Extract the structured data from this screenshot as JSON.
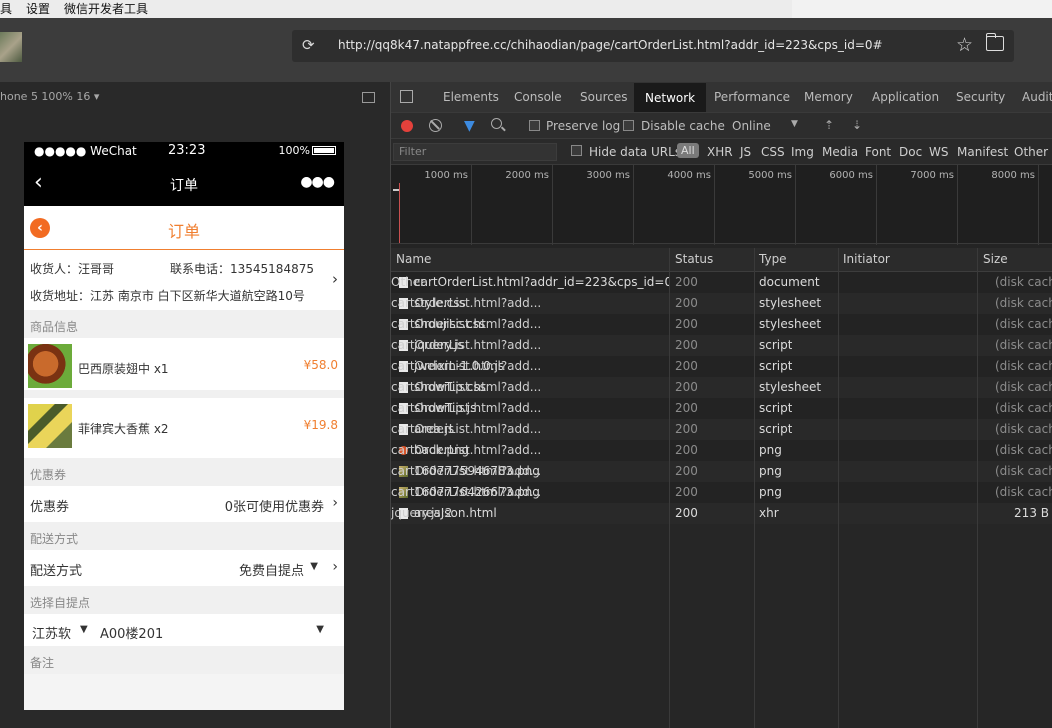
{
  "menu": {
    "items": [
      "具",
      "设置",
      "微信开发者工具"
    ]
  },
  "toolbar": {
    "url": "http://qq8k47.natappfree.cc/chihaodian/page/cartOrderList.html?addr_id=223&cps_id=0#"
  },
  "simulator": {
    "device_label": "hone 5 100% 16 ▾",
    "status": {
      "signal": "●●●●● WeChat",
      "time": "23:23",
      "battery": "100%"
    },
    "navbar_title": "订单",
    "order_title": "订单",
    "address": {
      "receiver": "收货人：汪哥哥",
      "phone": "联系电话：13545184875",
      "address": "收货地址：江苏 南京市 白下区新华大道航空路10号"
    },
    "goods_section": "商品信息",
    "products": [
      {
        "name": "巴西原装翅中 x1",
        "price": "¥58.0"
      },
      {
        "name": "菲律宾大香蕉 x2",
        "price": "¥19.8"
      }
    ],
    "coupon_section": "优惠券",
    "coupon_label": "优惠券",
    "coupon_value": "0张可使用优惠券",
    "delivery_section": "配送方式",
    "delivery_label": "配送方式",
    "delivery_value": "免费自提点",
    "pickup_section": "选择自提点",
    "pickup_province": "江苏软",
    "pickup_point": "A00楼201",
    "remark_section": "备注"
  },
  "devtools": {
    "tabs": [
      "Elements",
      "Console",
      "Sources",
      "Network",
      "Performance",
      "Memory",
      "Application",
      "Security",
      "Audit"
    ],
    "active_tab": "Network",
    "preserve_log": "Preserve log",
    "disable_cache": "Disable cache",
    "throttle": "Online",
    "filter_placeholder": "Filter",
    "hide_data_urls": "Hide data URLs",
    "types": [
      "All",
      "XHR",
      "JS",
      "CSS",
      "Img",
      "Media",
      "Font",
      "Doc",
      "WS",
      "Manifest",
      "Other"
    ],
    "timeline_ticks": [
      "1000 ms",
      "2000 ms",
      "3000 ms",
      "4000 ms",
      "5000 ms",
      "6000 ms",
      "7000 ms",
      "8000 ms"
    ],
    "columns": {
      "name": "Name",
      "status": "Status",
      "type": "Type",
      "initiator": "Initiator",
      "size": "Size"
    },
    "requests": [
      {
        "name": "cartOrderList.html?addr_id=223&cps_id=0",
        "status": "200",
        "type": "document",
        "initiator": "Other",
        "size": "(disk cache)"
      },
      {
        "name": "style.css",
        "status": "200",
        "type": "stylesheet",
        "initiator": "cartOrderList.html?add...",
        "size": "(disk cache)"
      },
      {
        "name": "shoujisc.css",
        "status": "200",
        "type": "stylesheet",
        "initiator": "cartOrderList.html?add...",
        "size": "(disk cache)"
      },
      {
        "name": "jquery.js",
        "status": "200",
        "type": "script",
        "initiator": "cartOrderList.html?add...",
        "size": "(disk cache)"
      },
      {
        "name": "jweixin-1.0.0.js",
        "status": "200",
        "type": "script",
        "initiator": "cartOrderList.html?add...",
        "size": "(disk cache)"
      },
      {
        "name": "showTip.css",
        "status": "200",
        "type": "stylesheet",
        "initiator": "cartOrderList.html?add...",
        "size": "(disk cache)"
      },
      {
        "name": "showTip.js",
        "status": "200",
        "type": "script",
        "initiator": "cartOrderList.html?add...",
        "size": "(disk cache)"
      },
      {
        "name": "area.js",
        "status": "200",
        "type": "script",
        "initiator": "cartOrderList.html?add...",
        "size": "(disk cache)"
      },
      {
        "name": "back.png",
        "status": "200",
        "type": "png",
        "initiator": "cartOrderList.html?add...",
        "size": "(disk cache)"
      },
      {
        "name": "1607775946783.png",
        "status": "200",
        "type": "png",
        "initiator": "cartOrderList.html?add...",
        "size": "(disk cache)"
      },
      {
        "name": "1607776426673.png",
        "status": "200",
        "type": "png",
        "initiator": "cartOrderList.html?add...",
        "size": "(disk cache)"
      },
      {
        "name": "areaJson.html",
        "status": "200",
        "type": "xhr",
        "initiator": "jquery.js:2",
        "size": "213 B"
      }
    ]
  }
}
